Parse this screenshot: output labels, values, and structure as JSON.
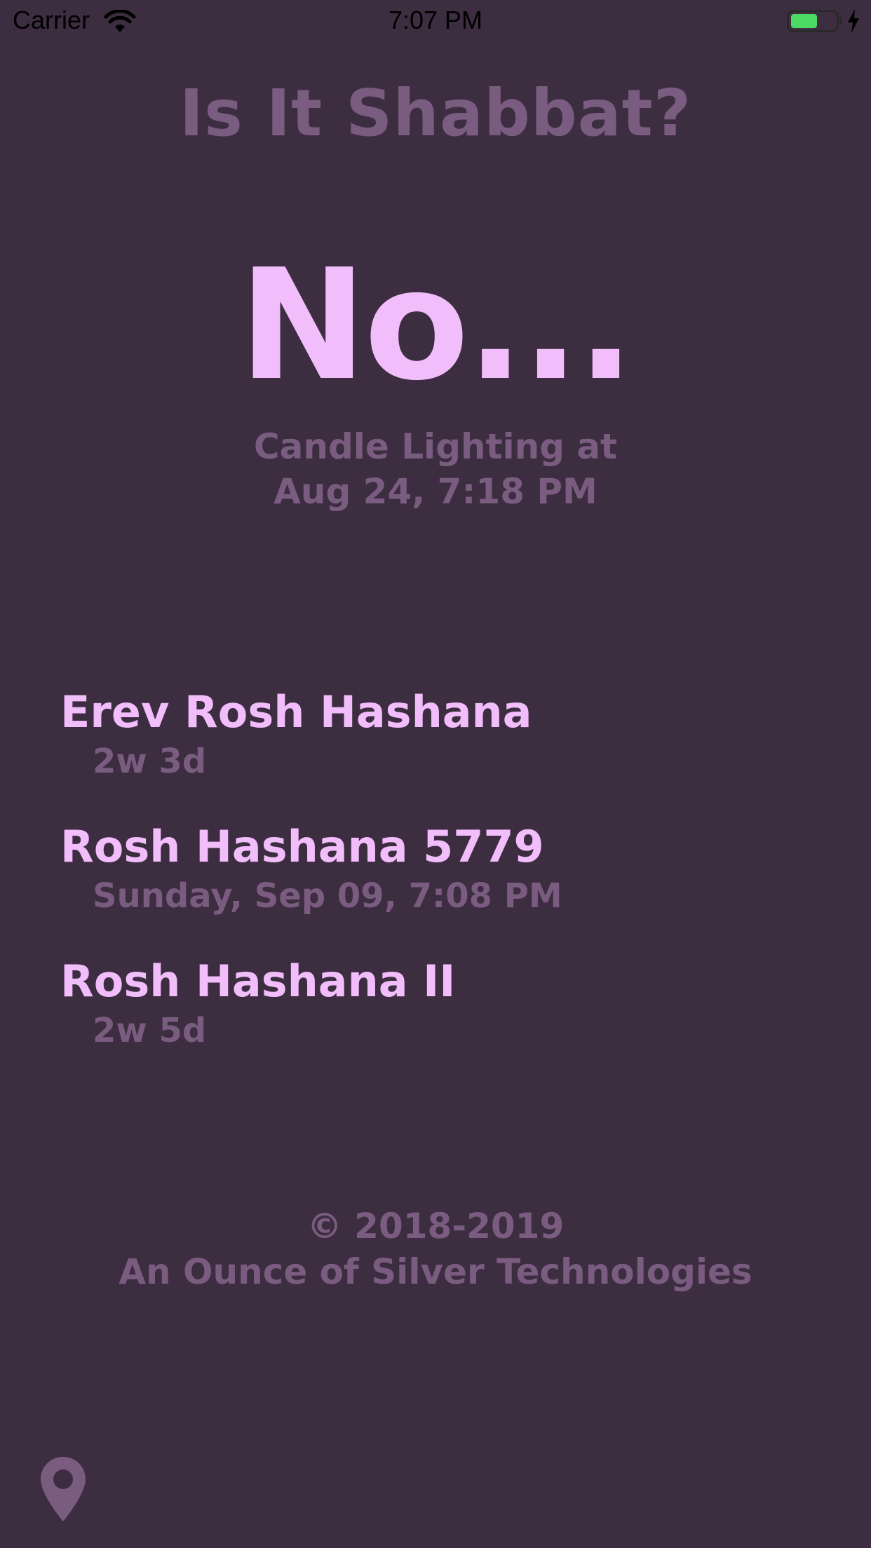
{
  "status_bar": {
    "carrier": "Carrier",
    "time": "7:07 PM",
    "battery_level": 0.6,
    "wifi_icon": "wifi-icon",
    "charging_icon": "charging-bolt-icon"
  },
  "header": {
    "title": "Is It Shabbat?"
  },
  "answer": {
    "text": "No..."
  },
  "next_shabbat": {
    "label": "Candle Lighting at",
    "datetime": "Aug 24, 7:18 PM"
  },
  "events": [
    {
      "name": "Erev Rosh Hashana",
      "when": "2w 3d"
    },
    {
      "name": "Rosh Hashana 5779",
      "when": "Sunday, Sep 09, 7:08 PM"
    },
    {
      "name": "Rosh Hashana II",
      "when": "2w 5d"
    }
  ],
  "footer": {
    "copyright": "© 2018-2019",
    "company": "An Ounce of Silver Technologies"
  },
  "controls": {
    "location_icon": "location-pin-icon"
  },
  "colors": {
    "background": "#3d2d41",
    "accent": "#f2bdfb",
    "muted": "#7a5c80",
    "battery_fill": "#4cd964"
  }
}
